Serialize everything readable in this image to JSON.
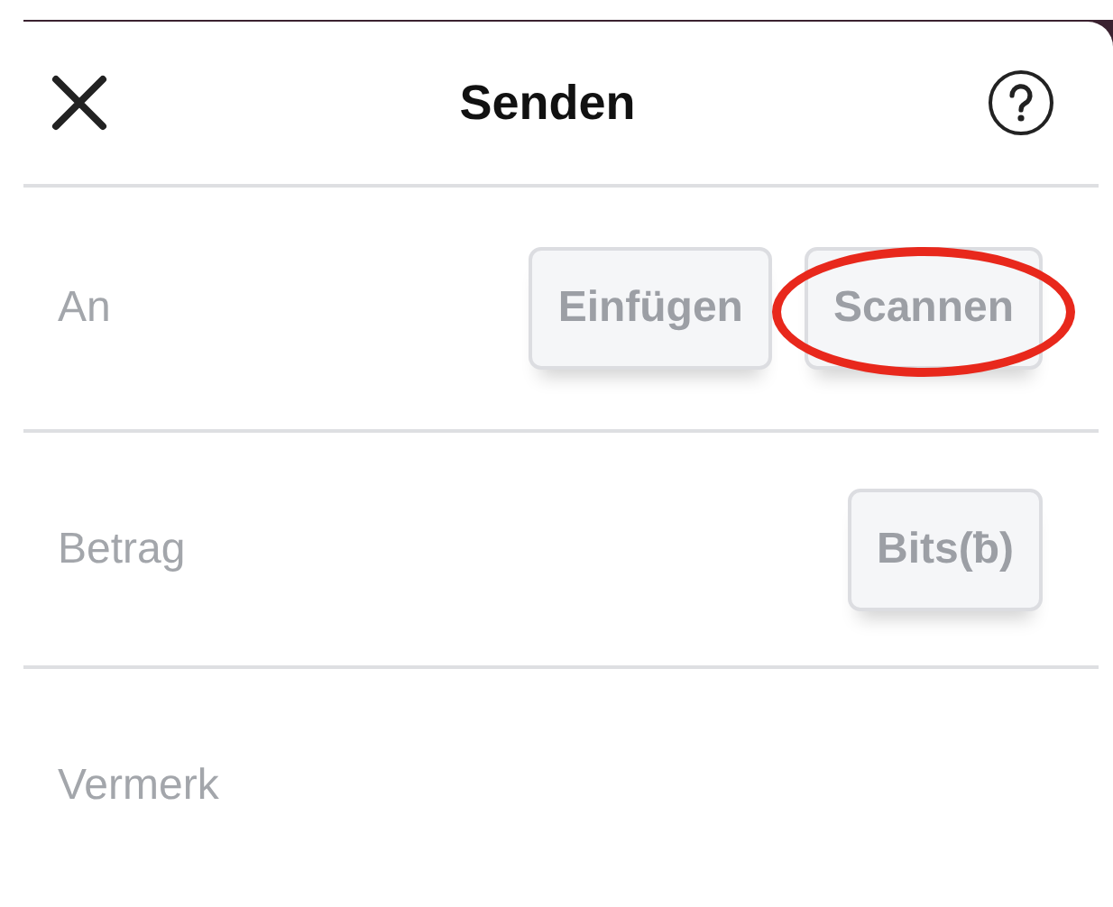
{
  "header": {
    "title": "Senden"
  },
  "rows": [
    {
      "label": "An",
      "buttons": [
        {
          "label": "Einfügen",
          "highlighted": false
        },
        {
          "label": "Scannen",
          "highlighted": true
        }
      ]
    },
    {
      "label": "Betrag",
      "buttons": [
        {
          "label": "Bits(ƀ)",
          "highlighted": false
        }
      ]
    },
    {
      "label": "Vermerk",
      "buttons": []
    }
  ]
}
